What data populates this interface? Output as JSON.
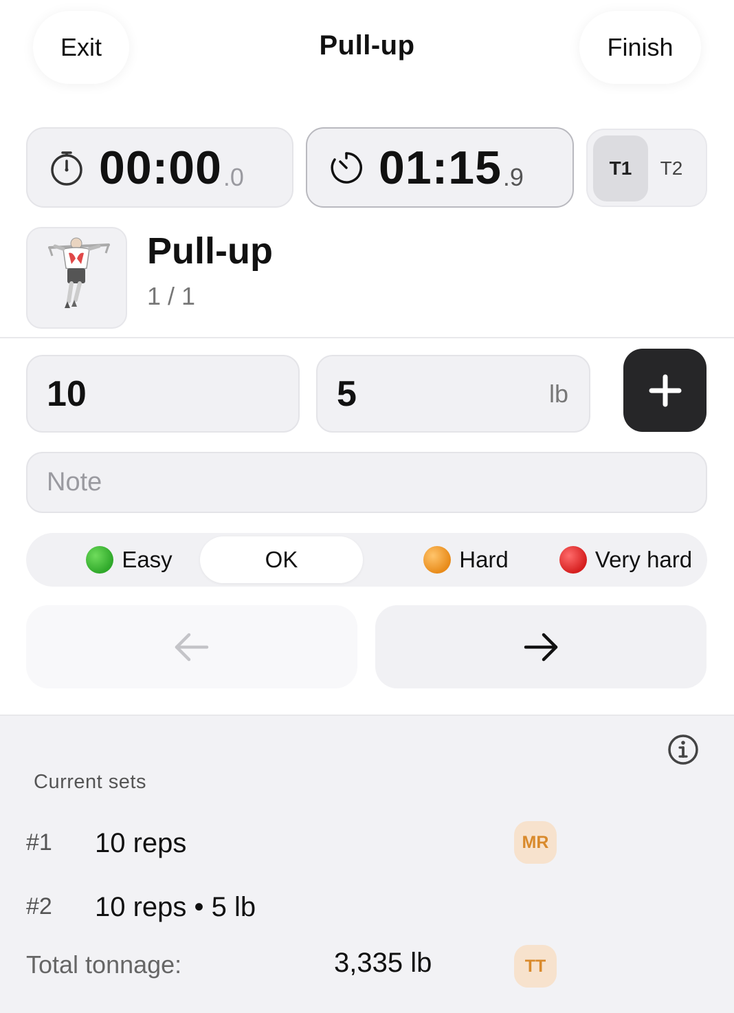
{
  "header": {
    "exit_label": "Exit",
    "title": "Pull-up",
    "finish_label": "Finish"
  },
  "timers": {
    "timer1": {
      "main": "00:00",
      "fraction": ".0"
    },
    "timer2": {
      "main": "01:15",
      "fraction": ".9"
    },
    "selector": {
      "options": [
        "T1",
        "T2"
      ],
      "selected": "T1"
    }
  },
  "exercise": {
    "name": "Pull-up",
    "set_progress": "1 / 1"
  },
  "inputs": {
    "reps_value": "10",
    "weight_value": "5",
    "weight_unit": "lb",
    "note_placeholder": "Note"
  },
  "difficulty": {
    "options": [
      {
        "label": "Easy",
        "color": "#2fa82a"
      },
      {
        "label": "OK",
        "color": ""
      },
      {
        "label": "Hard",
        "color": "#e88b1a"
      },
      {
        "label": "Very hard",
        "color": "#d51f1f"
      }
    ],
    "selected": "OK"
  },
  "navigation": {
    "prev_icon": "arrow-left-icon",
    "next_icon": "arrow-right-icon"
  },
  "current_sets": {
    "title": "Current sets",
    "sets": [
      {
        "number": "#1",
        "description": "10 reps",
        "badge": "MR"
      },
      {
        "number": "#2",
        "description": "10 reps • 5 lb",
        "badge": ""
      }
    ],
    "tonnage_label": "Total tonnage:",
    "tonnage_value": "3,335 lb",
    "tonnage_badge": "TT"
  },
  "colors": {
    "accent_dark": "#262628",
    "badge_bg": "#f7e2cd",
    "badge_text": "#d98a2c"
  }
}
